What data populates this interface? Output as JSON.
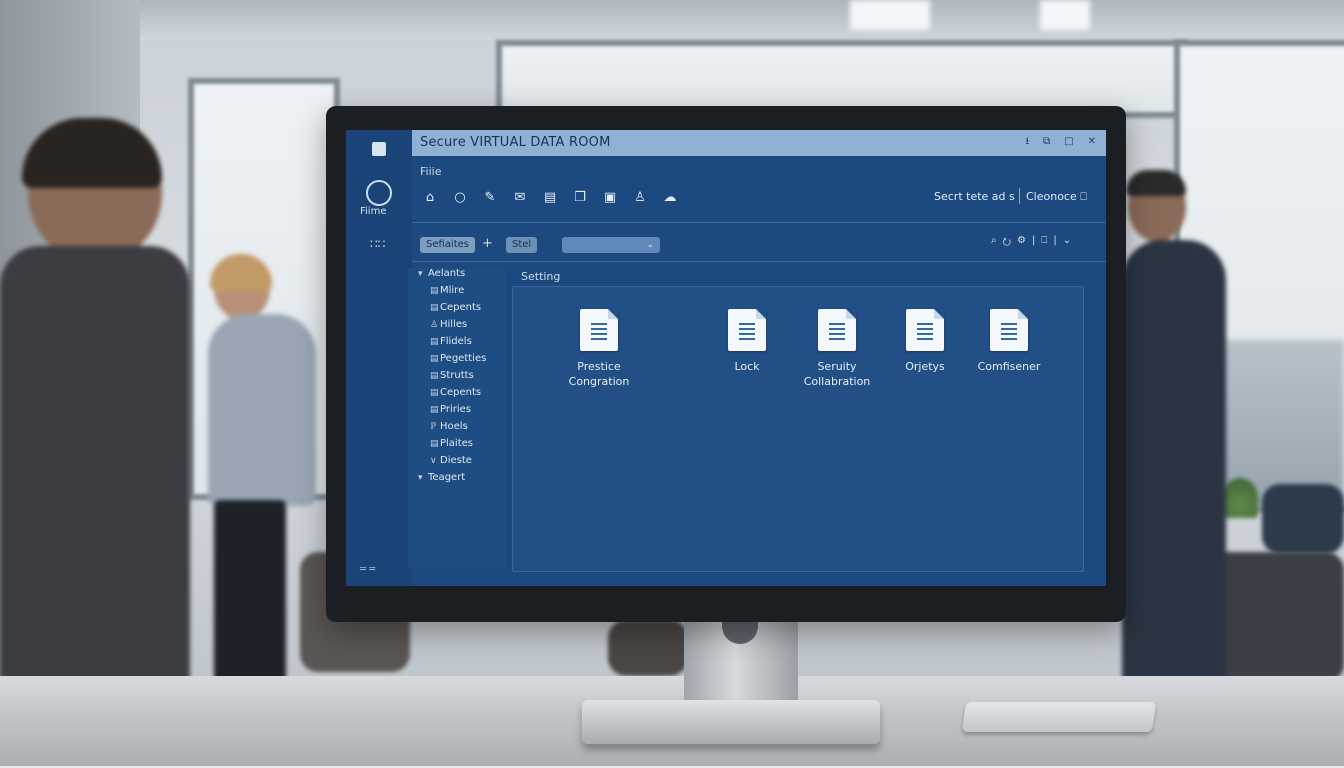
{
  "app": {
    "window_title": "Secure VIRTUAL DATA ROOM",
    "window_buttons": [
      "⭳",
      "⧉",
      "□",
      "✕"
    ]
  },
  "rail": {
    "home_label": "Fiime",
    "grid_icon": "∷∷",
    "bottom_icon": "═ ═"
  },
  "header": {
    "breadcrumb": "Fiiie",
    "toolbar_icons": [
      "⌂",
      "○",
      "✎",
      "✉",
      "▤",
      "❐",
      "▣",
      "♙",
      "☁"
    ],
    "status_text": "Secrt tete ad s",
    "status_link": "Cleonoce ⎕"
  },
  "filters": {
    "chip1": "Sefiaites",
    "plus": "+",
    "chip2": "Stel",
    "select_arrow": "⌄",
    "right_icons": [
      "⌕",
      "⭮",
      "⚙",
      "|",
      "⎕",
      "|",
      "⌄"
    ]
  },
  "tree": {
    "items": [
      {
        "icon": "▾",
        "label": "Aelants"
      },
      {
        "icon": "▤",
        "label": "Mlire"
      },
      {
        "icon": "▤",
        "label": "Cepents"
      },
      {
        "icon": "♙",
        "label": "Hilles"
      },
      {
        "icon": "▤",
        "label": "Flidels"
      },
      {
        "icon": "▤",
        "label": "Pegetties"
      },
      {
        "icon": "▤",
        "label": "Strutts"
      },
      {
        "icon": "▤",
        "label": "Cepents"
      },
      {
        "icon": "▤",
        "label": "Priries"
      },
      {
        "icon": "ℙ",
        "label": "Hoels"
      },
      {
        "icon": "▤",
        "label": "Plaites"
      },
      {
        "icon": "∨",
        "label": "Dieste"
      },
      {
        "icon": "▾",
        "label": "Teagert"
      }
    ]
  },
  "main": {
    "section_label": "Setting",
    "files": [
      {
        "line1": "Prestice",
        "line2": "Congration"
      },
      {
        "line1": "Lock",
        "line2": ""
      },
      {
        "line1": "Seruity",
        "line2": "Collabration"
      },
      {
        "line1": "Orjetys",
        "line2": ""
      },
      {
        "line1": "Comfisener",
        "line2": ""
      }
    ]
  },
  "colors": {
    "screen": "#1c4a80",
    "titlebar": "#8fb1d4",
    "pane": "#214f86"
  }
}
